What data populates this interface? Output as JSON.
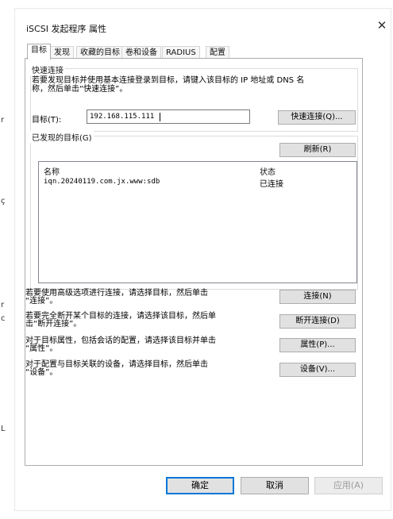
{
  "window": {
    "title": "iSCSI 发起程序 属性",
    "close_icon": "close-icon"
  },
  "tabs": [
    {
      "label": "目标",
      "active": true
    },
    {
      "label": "发现",
      "active": false
    },
    {
      "label": "收藏的目标",
      "active": false
    },
    {
      "label": "卷和设备",
      "active": false
    },
    {
      "label": "RADIUS",
      "active": false
    },
    {
      "label": "配置",
      "active": false
    }
  ],
  "quick_connect": {
    "group_title": "快速连接",
    "description_line1": "若要发现目标并使用基本连接登录到目标，请键入该目标的 IP 地址或 DNS 名",
    "description_line2": "称，然后单击“快速连接”。",
    "target_label": "目标(T):",
    "target_value": "192.168.115.111",
    "button_label": "快速连接(Q)..."
  },
  "discovered": {
    "group_title": "已发现的目标(G)",
    "refresh_label": "刷新(R)",
    "columns": {
      "name": "名称",
      "status": "状态"
    },
    "rows": [
      {
        "name": "iqn.20240119.com.jx.www:sdb",
        "status": "已连接"
      }
    ]
  },
  "actions": [
    {
      "line1": "若要使用高级选项进行连接，请选择目标，然后单击",
      "line2": "“连接”。",
      "button": "连接(N)"
    },
    {
      "line1": "若要完全断开某个目标的连接，请选择该目标，然后单",
      "line2": "击“断开连接”。",
      "button": "断开连接(D)"
    },
    {
      "line1": "对于目标属性，包括会话的配置，请选择该目标并单击",
      "line2": "“属性”。",
      "button": "属性(P)..."
    },
    {
      "line1": "对于配置与目标关联的设备，请选择目标，然后单击",
      "line2": "“设备”。",
      "button": "设备(V)..."
    }
  ],
  "footer": {
    "ok": "确定",
    "cancel": "取消",
    "apply": "应用(A)",
    "apply_enabled": false
  },
  "left_edge_chars": [
    "r",
    "ç",
    "r",
    "c",
    "L"
  ]
}
